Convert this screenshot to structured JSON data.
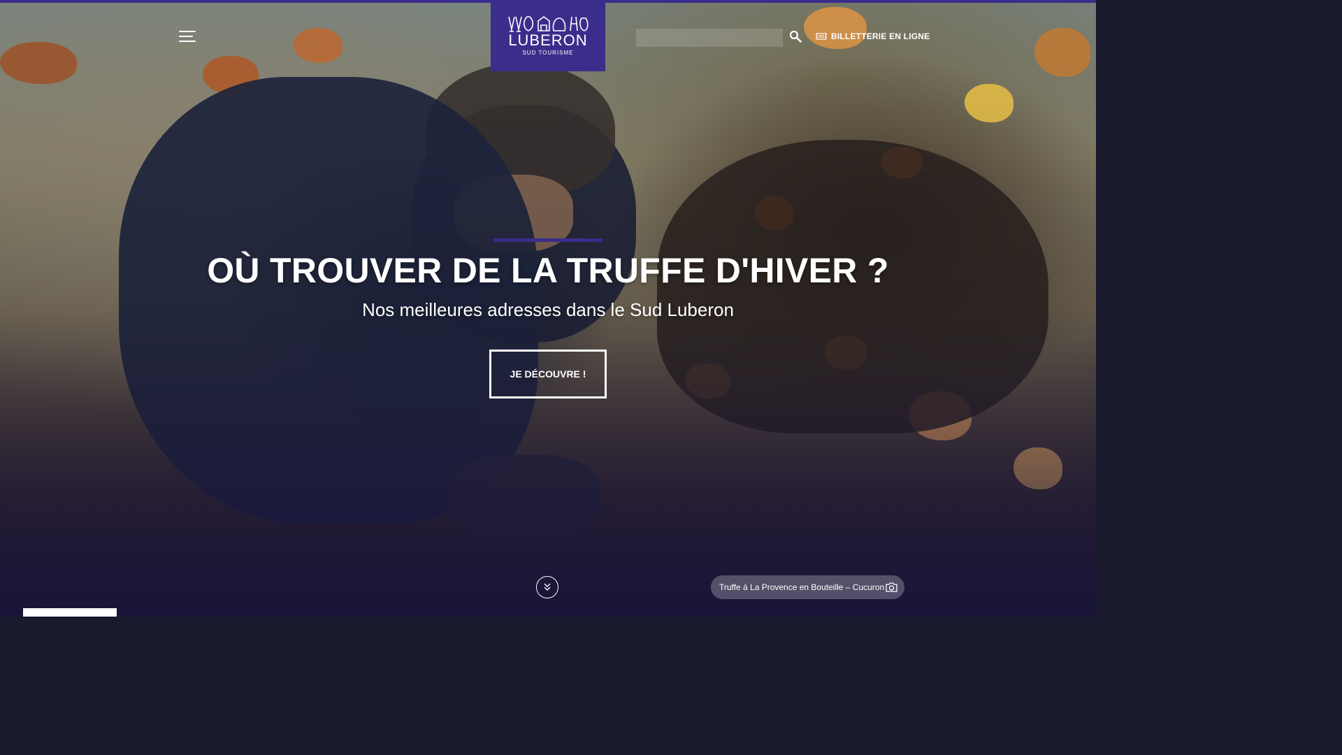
{
  "header": {
    "logo": {
      "brand": "LUBERON",
      "tagline": "SUD TOURISME"
    },
    "search": {
      "placeholder": ""
    },
    "ticketing_label": "BILLETTERIE EN LIGNE"
  },
  "hero": {
    "title": "OÙ TROUVER DE LA TRUFFE D'HIVER ?",
    "subtitle": "Nos meilleures adresses dans le Sud Luberon",
    "cta_label": "JE DÉCOUVRE !",
    "photo_caption": "Truffe à La Provence en Bouteille – Cucuron"
  },
  "icons": {
    "menu": "hamburger-menu-icon",
    "search": "search-icon",
    "ticket": "ticket-icon",
    "scroll": "chevron-double-down-icon",
    "camera": "camera-icon"
  },
  "colors": {
    "brand": "#3b2d8c",
    "text": "#ffffff"
  }
}
